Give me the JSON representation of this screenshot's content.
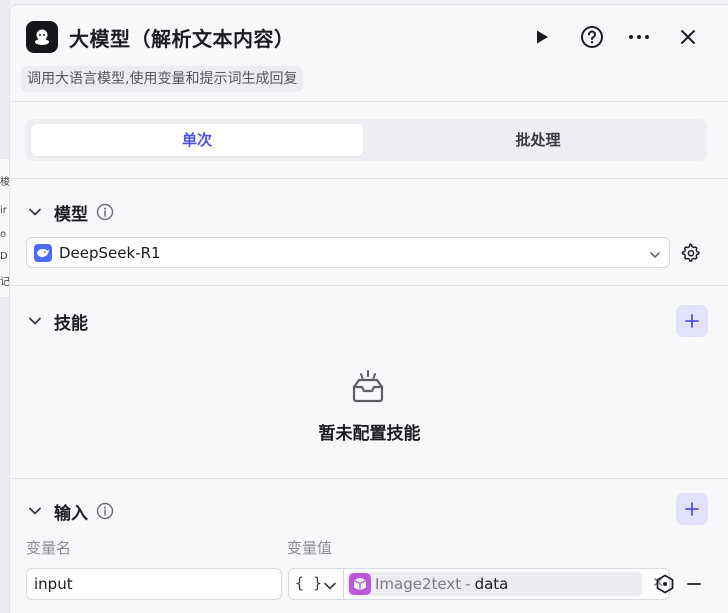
{
  "background_canvas": {
    "fragments": [
      "梭",
      "ir",
      "o",
      "D",
      "记"
    ]
  },
  "header": {
    "title": "大模型（解析文本内容）",
    "description": "调用大语言模型,使用变量和提示词生成回复",
    "icons": [
      "play-icon",
      "help-icon",
      "more-icon",
      "close-icon"
    ]
  },
  "tabs": [
    {
      "label": "单次",
      "active": true
    },
    {
      "label": "批处理",
      "active": false
    }
  ],
  "model_section": {
    "label": "模型",
    "selected_model": "DeepSeek-R1"
  },
  "skills_section": {
    "label": "技能",
    "empty_text": "暂未配置技能"
  },
  "input_section": {
    "label": "输入",
    "col_name_label": "变量名",
    "col_value_label": "变量值",
    "rows": [
      {
        "name": "input",
        "type_symbol": "{ }",
        "ref_node": "Image2text",
        "ref_separator": "-",
        "ref_field": "data"
      }
    ]
  },
  "colors": {
    "accent": "#4d53e8",
    "accent_bg": "#e2e3fb",
    "tag_icon": "#b85ad9",
    "deepseek": "#4d6bfe"
  }
}
